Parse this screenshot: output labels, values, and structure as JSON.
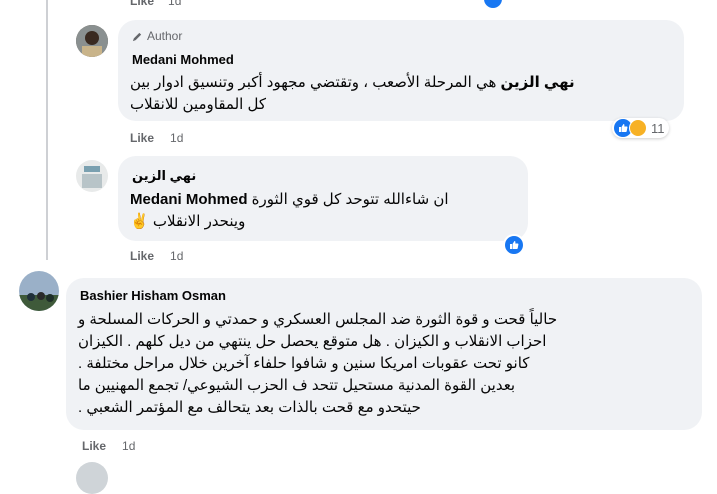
{
  "top_row": {
    "like": "Like",
    "time": "1d"
  },
  "comment1": {
    "author_badge": "Author",
    "name": "Medani Mohmed",
    "tag": "نهي الزين",
    "text_line1": " هي المرحلة الأصعب ، وتقتضي مجهود أكبر وتنسيق ادوار بين",
    "text_line2": "كل المقاومين للانقلاب",
    "like": "Like",
    "time": "1d",
    "reaction_count": "11"
  },
  "comment2": {
    "name": "نهي الزين",
    "text_line1": "ان شاءالله تتوحد كل قوي الثورة ",
    "tag": "Medani Mohmed",
    "text_line2": "وينحدر الانقلاب ✌️",
    "like": "Like",
    "time": "1d"
  },
  "comment3": {
    "name": "Bashier Hisham Osman",
    "lines": [
      "حالياً قحت و قوة الثورة ضد المجلس العسكري و حمدتي و الحركات المسلحة و",
      "احزاب الانقلاب و الكيزان . هل متوقع يحصل حل ينتهي من ديل كلهم . الكيزان",
      "كانو تحت عقوبات امريكا سنين و شافوا حلفاء آخرين خلال مراحل مختلفة .",
      "بعدين القوة المدنية مستحيل تتحد ف الحزب الشيوعي/ تجمع المهنيين ما",
      "حيتحدو مع قحت بالذات بعد يتحالف مع المؤتمر الشعبي ."
    ],
    "like": "Like",
    "time": "1d"
  },
  "colors": {
    "bubble": "#f0f2f5",
    "like_blue": "#1877f2",
    "meta_gray": "#65676b"
  }
}
